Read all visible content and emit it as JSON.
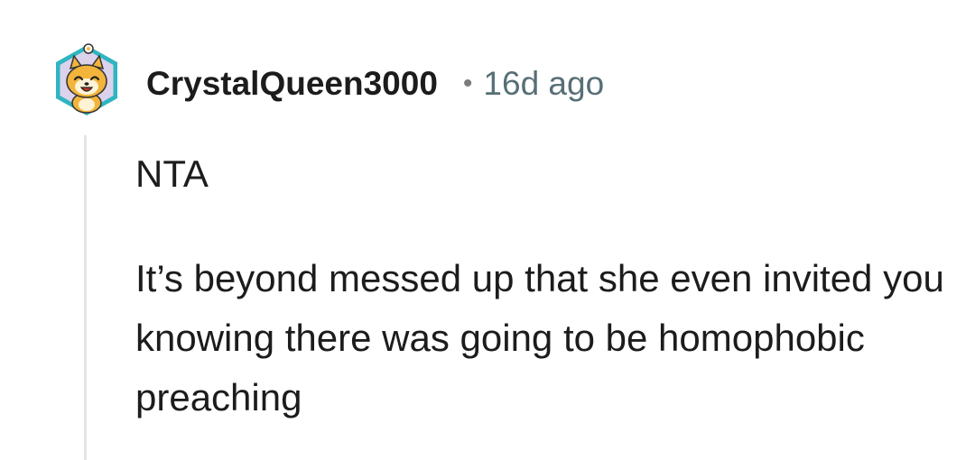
{
  "comment": {
    "author": "CrystalQueen3000",
    "separator": "•",
    "timestamp": "16d ago",
    "avatar_icon": "shiba-snoo-avatar-icon",
    "paragraphs": [
      "NTA",
      "It’s beyond messed up that she even invited you knowing there was going to be homophobic preaching"
    ]
  },
  "colors": {
    "text": "#1c1c1c",
    "meta": "#576f76",
    "thread_line": "#e4e4e4",
    "avatar_bg": "#dcd2ec",
    "avatar_ring": "#2fb5c0"
  }
}
